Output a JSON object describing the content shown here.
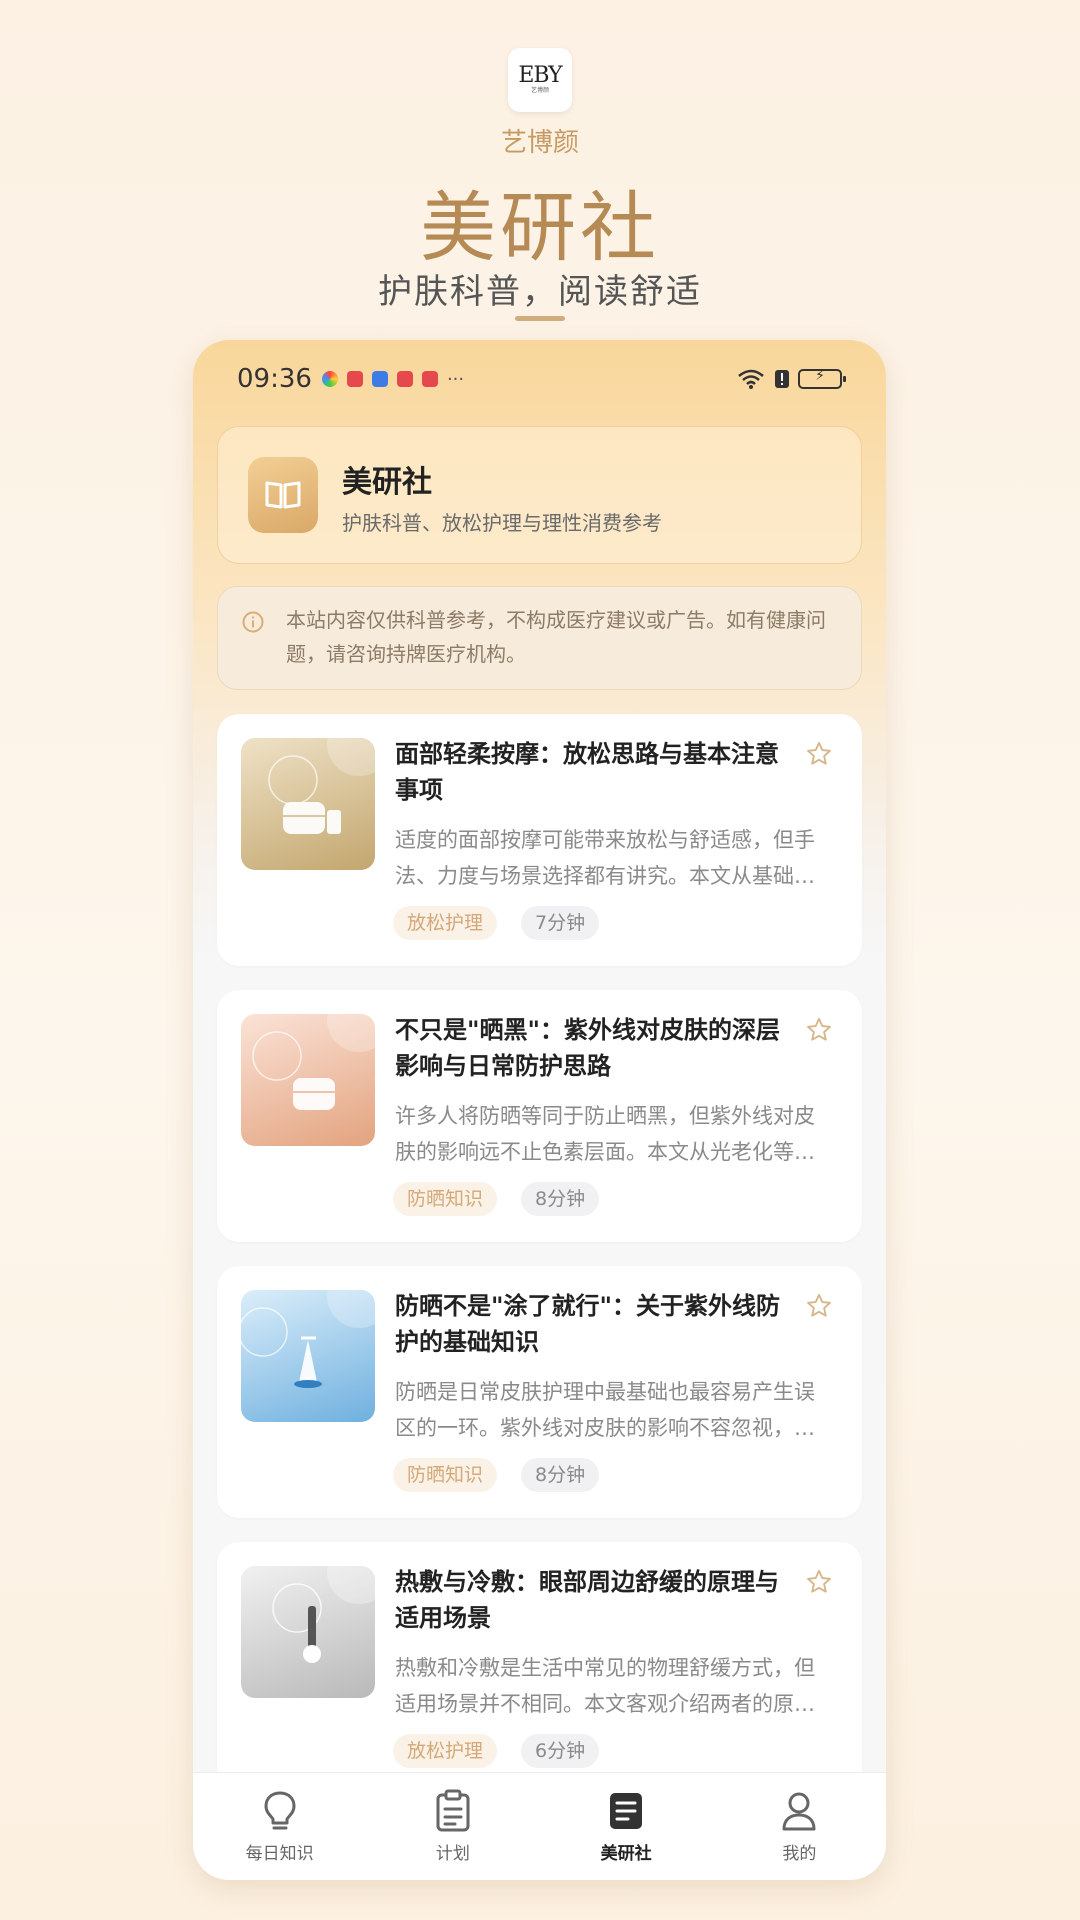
{
  "promo": {
    "logo_mark": "EBY",
    "logo_caption": "艺博颜",
    "brand": "艺博颜",
    "title": "美研社",
    "subtitle": "护肤科普，阅读舒适"
  },
  "status_bar": {
    "time": "09:36",
    "more": "···",
    "battery_icon": "battery-charging-icon"
  },
  "header": {
    "title": "美研社",
    "subtitle": "护肤科普、放松护理与理性消费参考"
  },
  "notice": {
    "text": "本站内容仅供科普参考，不构成医疗建议或广告。如有健康问题，请咨询持牌医疗机构。"
  },
  "articles": [
    {
      "title": "面部轻柔按摩：放松思路与基本注意事项",
      "desc": "适度的面部按摩可能带来放松与舒适感，但手法、力度与场景选择都有讲究。本文从基础原理出发，介绍常见的放松思路。",
      "category": "放松护理",
      "read_time": "7分钟",
      "thumb_colors": [
        "#efe2c7",
        "#c3a66e"
      ]
    },
    {
      "title": "不只是\"晒黑\"：紫外线对皮肤的深层影响与日常防护思路",
      "desc": "许多人将防晒等同于防止晒黑，但紫外线对皮肤的影响远不止色素层面。本文从光老化等角度进行说明。",
      "category": "防晒知识",
      "read_time": "8分钟",
      "thumb_colors": [
        "#fbe3d7",
        "#e3a37f"
      ]
    },
    {
      "title": "防晒不是\"涂了就行\"：关于紫外线防护的基础知识",
      "desc": "防晒是日常皮肤护理中最基础也最容易产生误区的一环。紫外线对皮肤的影响不容忽视，本文介绍相关基础知识。",
      "category": "防晒知识",
      "read_time": "8分钟",
      "thumb_colors": [
        "#dbeefa",
        "#6fb0df"
      ]
    },
    {
      "title": "热敷与冷敷：眼部周边舒缓的原理与适用场景",
      "desc": "热敷和冷敷是生活中常见的物理舒缓方式，但适用场景并不相同。本文客观介绍两者的原理与注意事项。",
      "category": "放松护理",
      "read_time": "6分钟",
      "thumb_colors": [
        "#f1f1f1",
        "#b9b9b9"
      ]
    }
  ],
  "tabs": [
    {
      "label": "每日知识",
      "icon": "lightbulb-icon"
    },
    {
      "label": "计划",
      "icon": "clipboard-icon"
    },
    {
      "label": "美研社",
      "icon": "article-icon",
      "active": true
    },
    {
      "label": "我的",
      "icon": "user-icon"
    }
  ]
}
